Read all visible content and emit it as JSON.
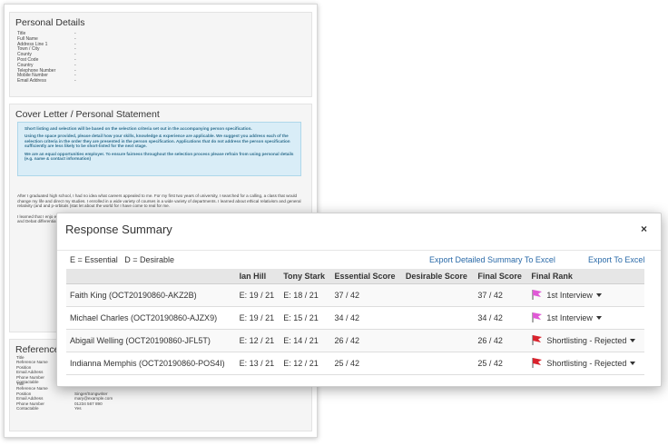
{
  "personal": {
    "title": "Personal Details",
    "fields": [
      {
        "label": "Title",
        "value": "-"
      },
      {
        "label": "Full Name",
        "value": "-"
      },
      {
        "label": "Address Line 1",
        "value": "-"
      },
      {
        "label": "Town / City",
        "value": "-"
      },
      {
        "label": "County",
        "value": "-"
      },
      {
        "label": "Post Code",
        "value": "-"
      },
      {
        "label": "Country",
        "value": "-"
      },
      {
        "label": "Telephone Number",
        "value": "-"
      },
      {
        "label": "Mobile Number",
        "value": "-"
      },
      {
        "label": "Email Address",
        "value": "-"
      }
    ]
  },
  "cover": {
    "title": "Cover Letter / Personal Statement",
    "alert": [
      "Short listing and selection will be based on the selection criteria set out in the accompanying person specification.",
      "Using the space provided, please detail how your skills, knowledge & experience are applicable. We suggest you address each of the selection criteria in the order they are presented in the person specification. Applications that do not address the person specification sufficiently are less likely to be short-listed for the next stage.",
      "We are an equal opportunities employer. To ensure fairness throughout the selection process please refrain from using personal details (e.g. name & contact information)"
    ],
    "body": [
      "After I graduated high school, I had no idea what careers appealed to me. For my first two years of university, I searched for a calling, a class that would change my life and direct my studies. I enrolled in a wide variety of courses in a wide variety of departments. I learned about ethical relativism and general relativity (and and p-orbitals (stat let about the world for I have come to real for me.",
      "I learned that I enjo economics, my unde have studied. I have policy. Similarly, law understanding of the perspectives, a skill numerous tourname Speaking and Debat differentiate a strong debating society."
    ]
  },
  "references": {
    "title": "References",
    "ref1": [
      {
        "label": "Title",
        "value": ""
      },
      {
        "label": "Reference Name",
        "value": ""
      },
      {
        "label": "Position",
        "value": ""
      },
      {
        "label": "Email Address",
        "value": ""
      },
      {
        "label": "Phone Number",
        "value": ""
      },
      {
        "label": "Contactable",
        "value": ""
      }
    ],
    "ref2": [
      {
        "label": "Title",
        "value": ""
      },
      {
        "label": "Reference Name",
        "value": ""
      },
      {
        "label": "Position",
        "value": "Singer/Songwriter"
      },
      {
        "label": "Email Address",
        "value": "mary@example.com"
      },
      {
        "label": "Phone Number",
        "value": "01234 567 890"
      },
      {
        "label": "Contactable",
        "value": "Yes"
      }
    ]
  },
  "modal": {
    "title": "Response Summary",
    "close": "×",
    "legend": "E = Essential   D = Desirable",
    "export_detailed": "Export Detailed Summary To Excel",
    "export_excel": "Export To Excel",
    "columns": [
      "",
      "Ian Hill",
      "Tony Stark",
      "Essential Score",
      "Desirable Score",
      "Final Score",
      "Final Rank"
    ],
    "rows": [
      {
        "name": "Faith King (OCT20190860-AKZ2B)",
        "ian": "E: 19 / 21",
        "tony": "E: 18 / 21",
        "essential": "37 / 42",
        "desirable": "",
        "final": "37 / 42",
        "rank": "1st Interview",
        "flag_color": "#e05ad6"
      },
      {
        "name": "Michael Charles (OCT20190860-AJZX9)",
        "ian": "E: 19 / 21",
        "tony": "E: 15 / 21",
        "essential": "34 / 42",
        "desirable": "",
        "final": "34 / 42",
        "rank": "1st Interview",
        "flag_color": "#e05ad6"
      },
      {
        "name": "Abigail Welling (OCT20190860-JFL5T)",
        "ian": "E: 12 / 21",
        "tony": "E: 14 / 21",
        "essential": "26 / 42",
        "desirable": "",
        "final": "26 / 42",
        "rank": "Shortlisting - Rejected",
        "flag_color": "#d9232d"
      },
      {
        "name": "Indianna Memphis (OCT20190860-POS4I)",
        "ian": "E: 13 / 21",
        "tony": "E: 12 / 21",
        "essential": "25 / 42",
        "desirable": "",
        "final": "25 / 42",
        "rank": "Shortlisting - Rejected",
        "flag_color": "#d9232d"
      }
    ]
  }
}
